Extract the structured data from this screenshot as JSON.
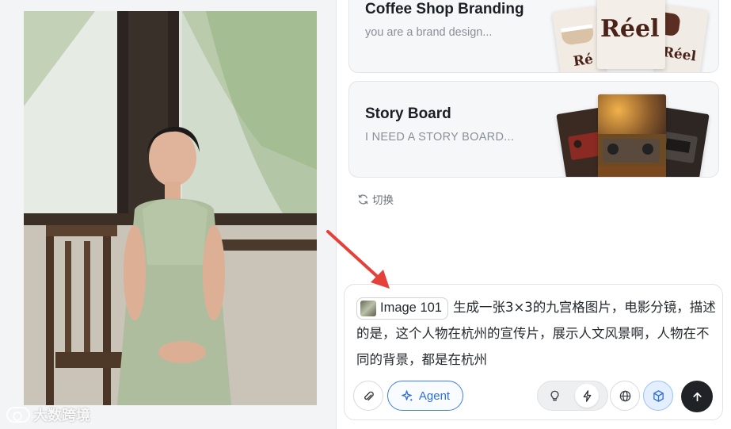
{
  "left": {
    "photo_alt": "",
    "watermark_text": "大数跨境"
  },
  "cards": [
    {
      "title": "Coffee Shop Branding",
      "subtitle": "you are a brand design...",
      "thumb_text": "Réel",
      "thumb_text_partial": "Ré"
    },
    {
      "title": "Story Board",
      "subtitle": "I NEED A STORY BOARD..."
    }
  ],
  "switch_label": "切换",
  "composer": {
    "image_chip_label": "Image 101",
    "prompt_text": "生成一张3×3的九宫格图片，电影分镜，描述的是，这个人物在杭州的宣传片，展示人文风景啊，人物在不同的背景，都是在杭州",
    "agent_label": "Agent"
  },
  "icons": {
    "attach": "paperclip-icon",
    "agent": "sparkle-icon",
    "idea": "lightbulb-icon",
    "fast": "lightning-icon",
    "globe": "globe-icon",
    "cube": "cube-icon",
    "send": "arrow-up-icon",
    "switch": "refresh-icon"
  },
  "colors": {
    "accent": "#2f6fe0",
    "send_bg": "#1f2226",
    "arrow": "#e5403a"
  }
}
